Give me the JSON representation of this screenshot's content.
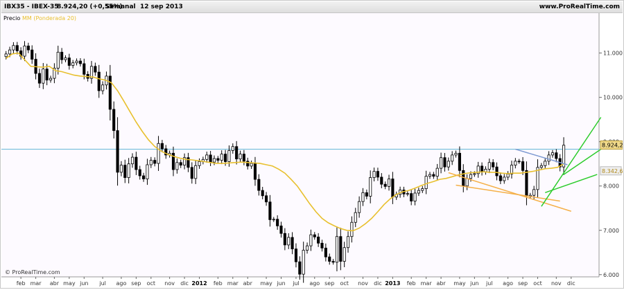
{
  "header": {
    "ticker": "IBX35 - IBEX-35",
    "last": "8.924,20 (+0,55%)",
    "period": "Semanal",
    "date": "12 sep 2013",
    "site": "www.ProRealTime.com"
  },
  "legend": {
    "price_label": "Precio",
    "ma_label": "MM (Ponderada 20)"
  },
  "watermark": "© ProRealTime.com",
  "colors": {
    "background": "#fdfaff",
    "candle_body": "#000000",
    "moving_average": "#e8c02e",
    "horizontal_line": "#5fb4d4",
    "trend_blue": "#7e9ad2",
    "channel_orange": "#f5b048",
    "channel_green": "#2ccc2c",
    "last_price_badge": "#f0d98a",
    "ma_badge": "#eeeeee"
  },
  "chart_data": {
    "type": "candlestick",
    "y_axis": {
      "min": 5950,
      "max": 11900,
      "ticks": [
        6000,
        7000,
        8000,
        9000,
        10000,
        11000
      ],
      "tick_labels": [
        "6.000",
        "7.000",
        "8.000",
        "9.000",
        "10.000",
        "11.000"
      ]
    },
    "x_axis": {
      "labels": [
        {
          "t": "feb",
          "w": 4
        },
        {
          "t": "mar",
          "w": 8
        },
        {
          "t": "abr",
          "w": 13
        },
        {
          "t": "may",
          "w": 17
        },
        {
          "t": "jun",
          "w": 21
        },
        {
          "t": "jul",
          "w": 26
        },
        {
          "t": "ago",
          "w": 31
        },
        {
          "t": "sep",
          "w": 35
        },
        {
          "t": "oct",
          "w": 39
        },
        {
          "t": "nov",
          "w": 44
        },
        {
          "t": "dic",
          "w": 48
        },
        {
          "t": "2012",
          "w": 52,
          "bold": true
        },
        {
          "t": "feb",
          "w": 57
        },
        {
          "t": "mar",
          "w": 61
        },
        {
          "t": "abr",
          "w": 65
        },
        {
          "t": "may",
          "w": 70
        },
        {
          "t": "jun",
          "w": 74
        },
        {
          "t": "jul",
          "w": 78
        },
        {
          "t": "ago",
          "w": 83
        },
        {
          "t": "sep",
          "w": 87
        },
        {
          "t": "oct",
          "w": 91
        },
        {
          "t": "nov",
          "w": 96
        },
        {
          "t": "dic",
          "w": 100
        },
        {
          "t": "2013",
          "w": 104,
          "bold": true
        },
        {
          "t": "feb",
          "w": 109
        },
        {
          "t": "mar",
          "w": 113
        },
        {
          "t": "abr",
          "w": 117
        },
        {
          "t": "may",
          "w": 122
        },
        {
          "t": "jun",
          "w": 126
        },
        {
          "t": "jul",
          "w": 130
        },
        {
          "t": "ago",
          "w": 135
        },
        {
          "t": "sep",
          "w": 139
        },
        {
          "t": "oct",
          "w": 143
        },
        {
          "t": "nov",
          "w": 148
        },
        {
          "t": "dic",
          "w": 152
        }
      ],
      "total_slots": 160
    },
    "series": [
      {
        "label": "Precio",
        "closes": [
          10980,
          11070,
          11170,
          11050,
          10930,
          11160,
          11070,
          10860,
          10540,
          10320,
          10640,
          10390,
          10430,
          10660,
          11020,
          10850,
          10890,
          10720,
          10780,
          10820,
          10760,
          10520,
          10430,
          10700,
          10570,
          10150,
          10280,
          10480,
          9730,
          9250,
          8310,
          8470,
          8190,
          8500,
          8650,
          8370,
          8230,
          8160,
          8480,
          8580,
          8510,
          8960,
          8840,
          8700,
          8740,
          8370,
          8530,
          8470,
          8640,
          8420,
          8170,
          8460,
          8550,
          8600,
          8700,
          8540,
          8620,
          8580,
          8720,
          8550,
          8800,
          8890,
          8610,
          8720,
          8560,
          8450,
          8510,
          8150,
          7900,
          7780,
          7640,
          7240,
          7250,
          7100,
          6930,
          6670,
          6840,
          6580,
          6290,
          6010,
          6550,
          6650,
          6900,
          6850,
          6710,
          6600,
          6400,
          6300,
          6280,
          6860,
          6300,
          6610,
          6860,
          7180,
          7400,
          7650,
          7850,
          7770,
          8190,
          8330,
          8200,
          8040,
          7990,
          8160,
          7750,
          7810,
          7910,
          7820,
          7830,
          7660,
          7840,
          7900,
          7940,
          8220,
          8260,
          8220,
          8400,
          8640,
          8430,
          8560,
          8700,
          8740,
          8350,
          8000,
          8170,
          8260,
          8280,
          8450,
          8320,
          8380,
          8530,
          8430,
          8230,
          8120,
          8200,
          8270,
          8470,
          8560,
          8550,
          8350,
          7770,
          7790,
          7920,
          8420,
          8460,
          8560,
          8700,
          8750,
          8620,
          8430,
          8920
        ],
        "ma": [
          10880,
          10980,
          11000,
          10850,
          10700,
          10690,
          10680,
          10700,
          10600,
          10580,
          10540,
          10500,
          10480,
          10470,
          10460,
          10420,
          10390,
          10330,
          10150,
          9920,
          9680,
          9440,
          9230,
          9040,
          8890,
          8790,
          8720,
          8670,
          8630,
          8600,
          8590,
          8570,
          8550,
          8530,
          8510,
          8510,
          8520,
          8530,
          8540,
          8530,
          8520,
          8510,
          8480,
          8450,
          8380,
          8290,
          8150,
          8000,
          7800,
          7600,
          7420,
          7270,
          7170,
          7100,
          7040,
          7000,
          6990,
          7050,
          7150,
          7270,
          7420,
          7580,
          7710,
          7810,
          7870,
          7900,
          7950,
          8010,
          8060,
          8100,
          8150,
          8170,
          8210,
          8250,
          8280,
          8300,
          8310,
          8320,
          8310,
          8310,
          8290,
          8280,
          8290,
          8290,
          8310,
          8330,
          8360,
          8390,
          8400,
          8420,
          8500
        ],
        "ma_start_index": 0
      }
    ],
    "last_price": "8.924,20",
    "ma_last": "8.342,6",
    "horizontal_level": 8830,
    "trendlines": [
      {
        "color": "trend_blue",
        "from": [
          137,
          8830
        ],
        "to": [
          151,
          8480
        ]
      },
      {
        "color": "channel_orange",
        "from": [
          119,
          8300
        ],
        "to": [
          152,
          7430
        ]
      },
      {
        "color": "channel_orange",
        "from": [
          121,
          8020
        ],
        "to": [
          149,
          7660
        ]
      },
      {
        "color": "channel_green",
        "from": [
          144,
          7540
        ],
        "to": [
          160,
          9550
        ]
      },
      {
        "color": "channel_green",
        "from": [
          145,
          7850
        ],
        "to": [
          159,
          8260
        ]
      },
      {
        "color": "channel_green",
        "from": [
          150,
          8260
        ],
        "to": [
          160,
          8830
        ]
      }
    ]
  }
}
